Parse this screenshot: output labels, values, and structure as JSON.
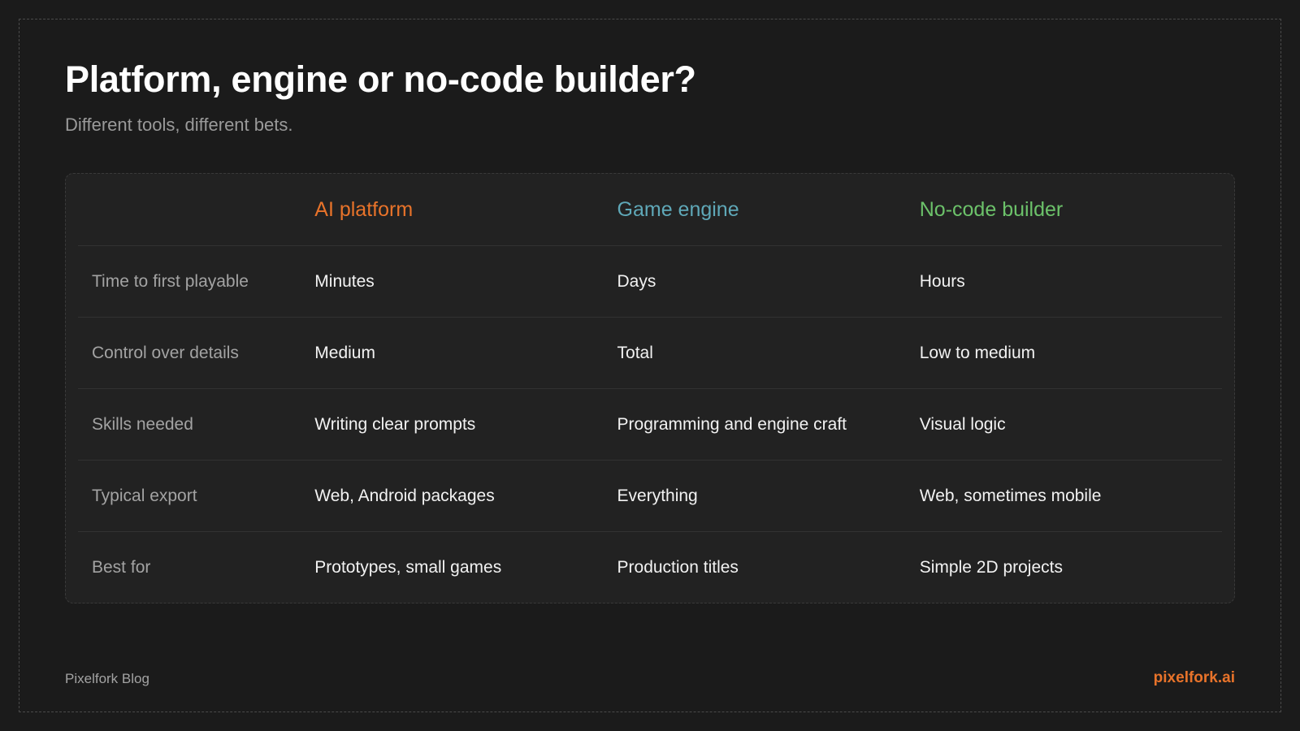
{
  "title": "Platform, engine or no-code builder?",
  "subtitle": "Different tools, different bets.",
  "colors": {
    "ai_platform": "#e8732a",
    "game_engine": "#5fa8b8",
    "no_code_builder": "#6cc26a",
    "brand": "#e8732a"
  },
  "table": {
    "columns": [
      "",
      "AI platform",
      "Game engine",
      "No-code builder"
    ],
    "rows": [
      [
        "Time to first playable",
        "Minutes",
        "Days",
        "Hours"
      ],
      [
        "Control over details",
        "Medium",
        "Total",
        "Low to medium"
      ],
      [
        "Skills needed",
        "Writing clear prompts",
        "Programming and engine craft",
        "Visual logic"
      ],
      [
        "Typical export",
        "Web, Android packages",
        "Everything",
        "Web, sometimes mobile"
      ],
      [
        "Best for",
        "Prototypes, small games",
        "Production titles",
        "Simple 2D projects"
      ]
    ]
  },
  "footer": {
    "left": "Pixelfork Blog",
    "right": "pixelfork.ai"
  }
}
